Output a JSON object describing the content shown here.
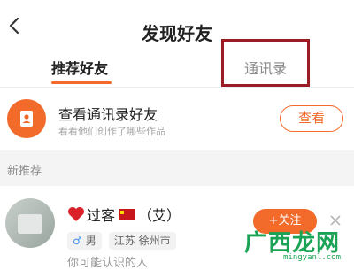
{
  "header": {
    "title": "发现好友"
  },
  "tabs": [
    {
      "label": "推荐好友"
    },
    {
      "label": "通讯录"
    }
  ],
  "contacts_entry": {
    "title": "查看通讯录好友",
    "subtitle": "看看他们创作了哪些作品",
    "button_label": "查看"
  },
  "section": {
    "label": "新推荐"
  },
  "user": {
    "name": "过客",
    "suffix": "（艾）",
    "tags": [
      {
        "label": "男",
        "icon": "male-icon"
      },
      {
        "label": "江苏 徐州市"
      }
    ],
    "follow_label": "+关注",
    "hint": "你可能认识的人"
  },
  "watermark": {
    "main": "广西龙网",
    "url": "mingyanl.com"
  },
  "colors": {
    "accent": "#f26b2a",
    "highlight": "#9b1c25",
    "watermark": "#1aa354"
  }
}
